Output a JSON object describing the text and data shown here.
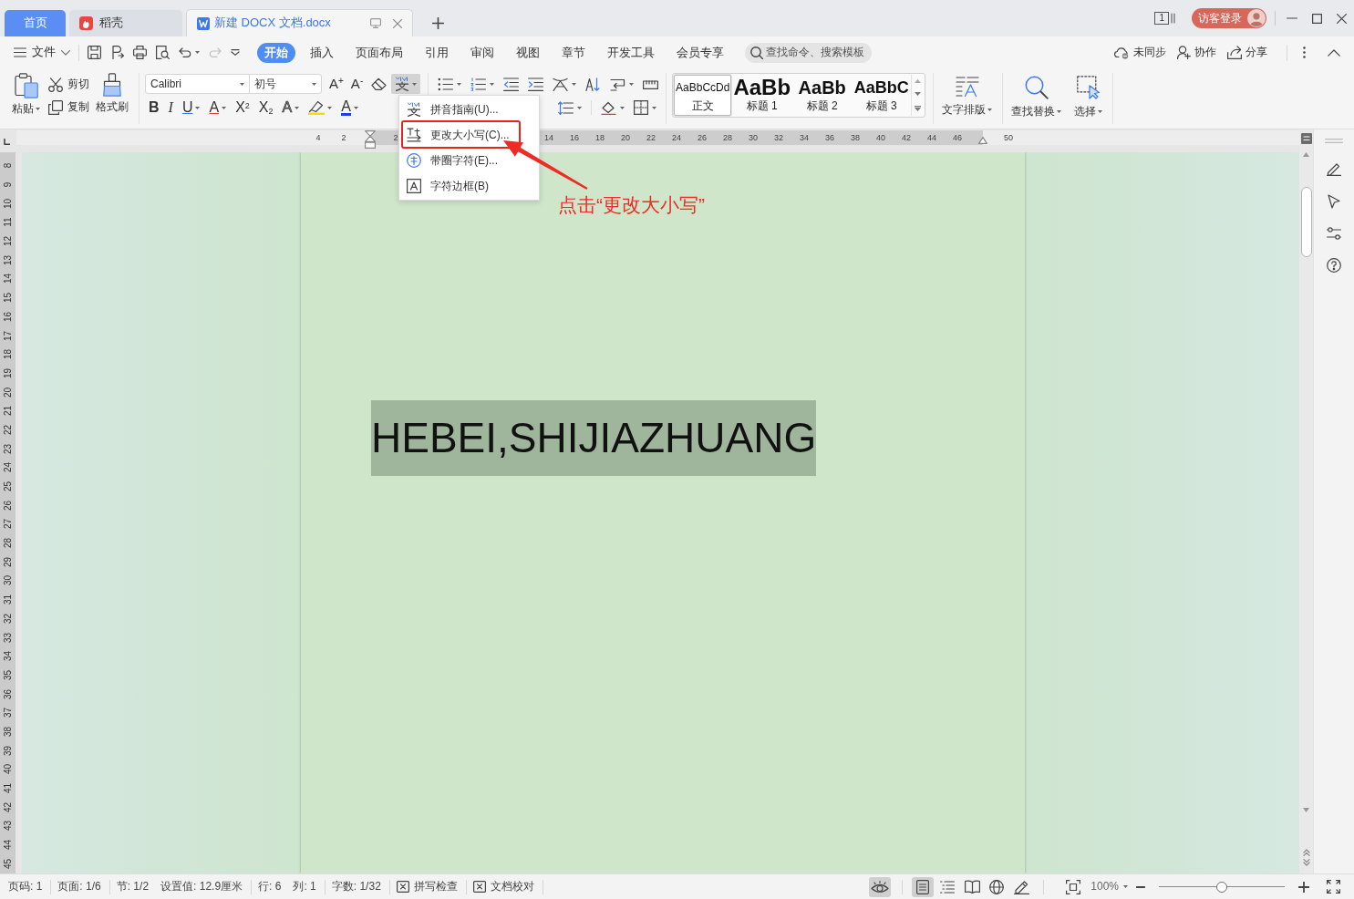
{
  "tab_bar": {
    "tabs": [
      {
        "kind": "home",
        "label": "首页",
        "selected": false
      },
      {
        "kind": "docer",
        "label": "稻壳",
        "selected": false
      },
      {
        "kind": "document",
        "label": "新建 DOCX 文档.docx",
        "selected": true
      }
    ],
    "window_count": "1",
    "login_button": "访客登录"
  },
  "menu_bar": {
    "file_menu": "文件",
    "redo": {
      "disabled": true
    },
    "ribbon_tabs": [
      {
        "label": "开始",
        "selected": true
      },
      {
        "label": "插入",
        "selected": false
      },
      {
        "label": "页面布局",
        "selected": false
      },
      {
        "label": "引用",
        "selected": false
      },
      {
        "label": "审阅",
        "selected": false
      },
      {
        "label": "视图",
        "selected": false
      },
      {
        "label": "章节",
        "selected": false
      },
      {
        "label": "开发工具",
        "selected": false
      },
      {
        "label": "会员专享",
        "selected": false
      }
    ],
    "search": {
      "placeholder": "查找命令、搜索模板"
    },
    "actions": [
      {
        "kind": "sync",
        "label": "未同步"
      },
      {
        "kind": "collaborate",
        "label": "协作"
      },
      {
        "kind": "share",
        "label": "分享"
      }
    ]
  },
  "ribbon": {
    "clipboard": {
      "paste": "粘贴",
      "cut": "剪切",
      "copy": "复制",
      "format_painter": "格式刷"
    },
    "font": {
      "family": "Calibri",
      "size": "初号",
      "grow": "A$^{+}$",
      "shrink": "A$^{-}$",
      "pinyin_guide": {
        "expanded": true
      },
      "formats": [
        {
          "kind": "bold",
          "glyph": "B"
        },
        {
          "kind": "italic",
          "glyph": "I"
        },
        {
          "kind": "underline",
          "glyph": "U"
        },
        {
          "kind": "strikethrough",
          "glyph": "A"
        },
        {
          "kind": "superscript",
          "glyph": "X$^{2}$"
        },
        {
          "kind": "subscript",
          "glyph": "X$_{2}$"
        },
        {
          "kind": "effects",
          "glyph": "A"
        },
        {
          "kind": "highlight"
        },
        {
          "kind": "font_color",
          "glyph": "A"
        }
      ]
    },
    "styles": [
      {
        "sample": "AaBbCcDd",
        "label": "正文",
        "selected": true
      },
      {
        "sample": "AaBb",
        "label": "标题 1",
        "selected": false
      },
      {
        "sample": "AaBb",
        "label": "标题 2",
        "selected": false
      },
      {
        "sample": "AaBbC",
        "label": "标题 3",
        "selected": false
      }
    ],
    "text_layout": "文字排版",
    "find_replace": "查找替换",
    "select": "选择"
  },
  "horizontal_ruler": {
    "left_margin_labels": [
      "4",
      "2"
    ],
    "text_labels": [
      "2",
      "14",
      "16",
      "18",
      "20",
      "22",
      "24",
      "26",
      "28",
      "30",
      "32",
      "34",
      "36",
      "38",
      "40",
      "42",
      "44",
      "46"
    ],
    "right_margin_labels": [
      "50"
    ]
  },
  "vertical_ruler": {
    "labels": [
      "8",
      "9",
      "10",
      "11",
      "12",
      "13",
      "14",
      "15",
      "16",
      "17",
      "18",
      "19",
      "20",
      "21",
      "22",
      "23",
      "24",
      "25",
      "26",
      "27",
      "28",
      "29",
      "30",
      "31",
      "32",
      "33",
      "34",
      "35",
      "36",
      "37",
      "38",
      "39",
      "40",
      "41",
      "42",
      "43",
      "44",
      "45"
    ]
  },
  "document": {
    "text": "HEBEI,SHIJIAZHUANG",
    "selected": true
  },
  "dropdown_menu": {
    "items": [
      {
        "kind": "pinyin",
        "label": "拼音指南(U)..."
      },
      {
        "kind": "change_case",
        "label": "更改大小写(C)..."
      },
      {
        "kind": "enclose",
        "label": "带圈字符(E)..."
      },
      {
        "kind": "border",
        "label": "字符边框(B)"
      }
    ]
  },
  "annotation": {
    "caption": "点击“更改大小写”"
  },
  "status_bar": {
    "groups": [
      [
        "页码: 1"
      ],
      [
        "页面: 1/6"
      ],
      [
        "节: 1/2",
        "设置值: 12.9厘米"
      ],
      [
        "行: 6",
        "列: 1"
      ],
      [
        "字数: 1/32"
      ]
    ],
    "checks": [
      "拼写检查",
      "文档校对"
    ],
    "eye_protection": {
      "on": true
    },
    "view_modes": [
      {
        "kind": "page",
        "selected": true
      },
      {
        "kind": "outline",
        "selected": false
      },
      {
        "kind": "reading",
        "selected": false
      },
      {
        "kind": "web",
        "selected": false
      },
      {
        "kind": "writing",
        "selected": false
      }
    ],
    "zoom": {
      "reading": "100%",
      "level": 0.5
    }
  }
}
